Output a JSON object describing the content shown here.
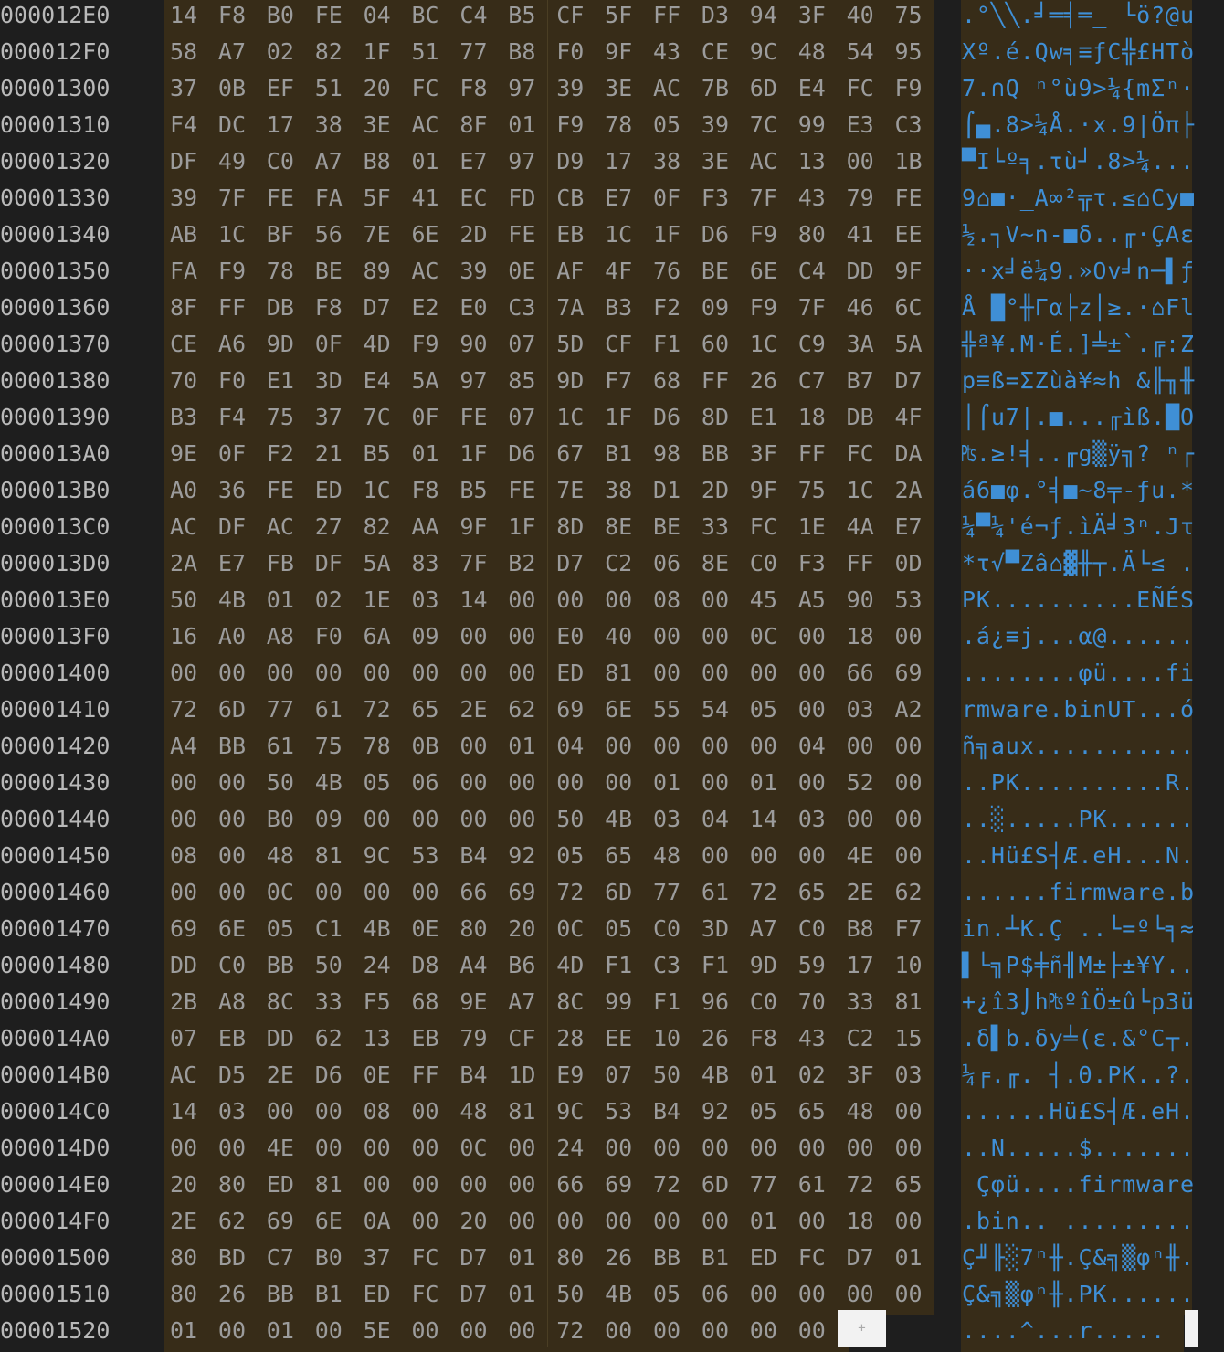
{
  "rows": [
    {
      "addr": "000012E0",
      "bytes": [
        "14",
        "F8",
        "B0",
        "FE",
        "04",
        "BC",
        "C4",
        "B5",
        "CF",
        "5F",
        "FF",
        "D3",
        "94",
        "3F",
        "40",
        "75"
      ],
      "ascii": ".°╲╲.╛═╡═_ └ö?@u"
    },
    {
      "addr": "000012F0",
      "bytes": [
        "58",
        "A7",
        "02",
        "82",
        "1F",
        "51",
        "77",
        "B8",
        "F0",
        "9F",
        "43",
        "CE",
        "9C",
        "48",
        "54",
        "95"
      ],
      "ascii": "Xº.é.Qw╕≡ƒC╬£HTò"
    },
    {
      "addr": "00001300",
      "bytes": [
        "37",
        "0B",
        "EF",
        "51",
        "20",
        "FC",
        "F8",
        "97",
        "39",
        "3E",
        "AC",
        "7B",
        "6D",
        "E4",
        "FC",
        "F9"
      ],
      "ascii": "7.∩Q ⁿ°ù9>¼{mΣⁿ·"
    },
    {
      "addr": "00001310",
      "bytes": [
        "F4",
        "DC",
        "17",
        "38",
        "3E",
        "AC",
        "8F",
        "01",
        "F9",
        "78",
        "05",
        "39",
        "7C",
        "99",
        "E3",
        "C3"
      ],
      "ascii": "⌠▄.8>¼Å.·x.9|Öπ├"
    },
    {
      "addr": "00001320",
      "bytes": [
        "DF",
        "49",
        "C0",
        "A7",
        "B8",
        "01",
        "E7",
        "97",
        "D9",
        "17",
        "38",
        "3E",
        "AC",
        "13",
        "00",
        "1B"
      ],
      "ascii": "▀I└º╕.τù┘.8>¼..."
    },
    {
      "addr": "00001330",
      "bytes": [
        "39",
        "7F",
        "FE",
        "FA",
        "5F",
        "41",
        "EC",
        "FD",
        "CB",
        "E7",
        "0F",
        "F3",
        "7F",
        "43",
        "79",
        "FE"
      ],
      "ascii": "9⌂■·_A∞²╦τ.≤⌂Cy■"
    },
    {
      "addr": "00001340",
      "bytes": [
        "AB",
        "1C",
        "BF",
        "56",
        "7E",
        "6E",
        "2D",
        "FE",
        "EB",
        "1C",
        "1F",
        "D6",
        "F9",
        "80",
        "41",
        "EE"
      ],
      "ascii": "½.┐V~n-■δ..╓·ÇAε"
    },
    {
      "addr": "00001350",
      "bytes": [
        "FA",
        "F9",
        "78",
        "BE",
        "89",
        "AC",
        "39",
        "0E",
        "AF",
        "4F",
        "76",
        "BE",
        "6E",
        "C4",
        "DD",
        "9F"
      ],
      "ascii": "··x╛ë¼9.»Ov╛n─▌ƒ"
    },
    {
      "addr": "00001360",
      "bytes": [
        "8F",
        "FF",
        "DB",
        "F8",
        "D7",
        "E2",
        "E0",
        "C3",
        "7A",
        "B3",
        "F2",
        "09",
        "F9",
        "7F",
        "46",
        "6C"
      ],
      "ascii": "Å █°╫Γα├z│≥.·⌂Fl"
    },
    {
      "addr": "00001370",
      "bytes": [
        "CE",
        "A6",
        "9D",
        "0F",
        "4D",
        "F9",
        "90",
        "07",
        "5D",
        "CF",
        "F1",
        "60",
        "1C",
        "C9",
        "3A",
        "5A"
      ],
      "ascii": "╬ª¥.M·É.]╧±`.╔:Z"
    },
    {
      "addr": "00001380",
      "bytes": [
        "70",
        "F0",
        "E1",
        "3D",
        "E4",
        "5A",
        "97",
        "85",
        "9D",
        "F7",
        "68",
        "FF",
        "26",
        "C7",
        "B7",
        "D7"
      ],
      "ascii": "p≡ß=ΣZùà¥≈h &╟╖╫"
    },
    {
      "addr": "00001390",
      "bytes": [
        "B3",
        "F4",
        "75",
        "37",
        "7C",
        "0F",
        "FE",
        "07",
        "1C",
        "1F",
        "D6",
        "8D",
        "E1",
        "18",
        "DB",
        "4F"
      ],
      "ascii": "│⌠u7|.■...╓ìß.█O"
    },
    {
      "addr": "000013A0",
      "bytes": [
        "9E",
        "0F",
        "F2",
        "21",
        "B5",
        "01",
        "1F",
        "D6",
        "67",
        "B1",
        "98",
        "BB",
        "3F",
        "FF",
        "FC",
        "DA"
      ],
      "ascii": "₧.≥!╡..╓g▒ÿ╗? ⁿ┌"
    },
    {
      "addr": "000013B0",
      "bytes": [
        "A0",
        "36",
        "FE",
        "ED",
        "1C",
        "F8",
        "B5",
        "FE",
        "7E",
        "38",
        "D1",
        "2D",
        "9F",
        "75",
        "1C",
        "2A"
      ],
      "ascii": "á6■φ.°╡■~8╤-ƒu.*"
    },
    {
      "addr": "000013C0",
      "bytes": [
        "AC",
        "DF",
        "AC",
        "27",
        "82",
        "AA",
        "9F",
        "1F",
        "8D",
        "8E",
        "BE",
        "33",
        "FC",
        "1E",
        "4A",
        "E7"
      ],
      "ascii": "¼▀¼'é¬ƒ.ìÄ╛3ⁿ.Jτ"
    },
    {
      "addr": "000013D0",
      "bytes": [
        "2A",
        "E7",
        "FB",
        "DF",
        "5A",
        "83",
        "7F",
        "B2",
        "D7",
        "C2",
        "06",
        "8E",
        "C0",
        "F3",
        "FF",
        "0D"
      ],
      "ascii": "*τ√▀Zâ⌂▓╫┬.Ä└≤ ."
    },
    {
      "addr": "000013E0",
      "bytes": [
        "50",
        "4B",
        "01",
        "02",
        "1E",
        "03",
        "14",
        "00",
        "00",
        "00",
        "08",
        "00",
        "45",
        "A5",
        "90",
        "53"
      ],
      "ascii": "PK..........EÑÉS"
    },
    {
      "addr": "000013F0",
      "bytes": [
        "16",
        "A0",
        "A8",
        "F0",
        "6A",
        "09",
        "00",
        "00",
        "E0",
        "40",
        "00",
        "00",
        "0C",
        "00",
        "18",
        "00"
      ],
      "ascii": ".á¿≡j...α@......"
    },
    {
      "addr": "00001400",
      "bytes": [
        "00",
        "00",
        "00",
        "00",
        "00",
        "00",
        "00",
        "00",
        "ED",
        "81",
        "00",
        "00",
        "00",
        "00",
        "66",
        "69"
      ],
      "ascii": "........φü....fi"
    },
    {
      "addr": "00001410",
      "bytes": [
        "72",
        "6D",
        "77",
        "61",
        "72",
        "65",
        "2E",
        "62",
        "69",
        "6E",
        "55",
        "54",
        "05",
        "00",
        "03",
        "A2"
      ],
      "ascii": "rmware.binUT...ó"
    },
    {
      "addr": "00001420",
      "bytes": [
        "A4",
        "BB",
        "61",
        "75",
        "78",
        "0B",
        "00",
        "01",
        "04",
        "00",
        "00",
        "00",
        "00",
        "04",
        "00",
        "00"
      ],
      "ascii": "ñ╗aux..........."
    },
    {
      "addr": "00001430",
      "bytes": [
        "00",
        "00",
        "50",
        "4B",
        "05",
        "06",
        "00",
        "00",
        "00",
        "00",
        "01",
        "00",
        "01",
        "00",
        "52",
        "00"
      ],
      "ascii": "..PK..........R."
    },
    {
      "addr": "00001440",
      "bytes": [
        "00",
        "00",
        "B0",
        "09",
        "00",
        "00",
        "00",
        "00",
        "50",
        "4B",
        "03",
        "04",
        "14",
        "03",
        "00",
        "00"
      ],
      "ascii": "..░.....PK......"
    },
    {
      "addr": "00001450",
      "bytes": [
        "08",
        "00",
        "48",
        "81",
        "9C",
        "53",
        "B4",
        "92",
        "05",
        "65",
        "48",
        "00",
        "00",
        "00",
        "4E",
        "00"
      ],
      "ascii": "..Hü£S┤Æ.eH...N."
    },
    {
      "addr": "00001460",
      "bytes": [
        "00",
        "00",
        "0C",
        "00",
        "00",
        "00",
        "66",
        "69",
        "72",
        "6D",
        "77",
        "61",
        "72",
        "65",
        "2E",
        "62"
      ],
      "ascii": "......firmware.b"
    },
    {
      "addr": "00001470",
      "bytes": [
        "69",
        "6E",
        "05",
        "C1",
        "4B",
        "0E",
        "80",
        "20",
        "0C",
        "05",
        "C0",
        "3D",
        "A7",
        "C0",
        "B8",
        "F7"
      ],
      "ascii": "in.┴K.Ç ..└=º└╕≈"
    },
    {
      "addr": "00001480",
      "bytes": [
        "DD",
        "C0",
        "BB",
        "50",
        "24",
        "D8",
        "A4",
        "B6",
        "4D",
        "F1",
        "C3",
        "F1",
        "9D",
        "59",
        "17",
        "10"
      ],
      "ascii": "▌└╗P$╪ñ╢M±├±¥Y.."
    },
    {
      "addr": "00001490",
      "bytes": [
        "2B",
        "A8",
        "8C",
        "33",
        "F5",
        "68",
        "9E",
        "A7",
        "8C",
        "99",
        "F1",
        "96",
        "C0",
        "70",
        "33",
        "81"
      ],
      "ascii": "+¿î3⌡h₧ºîÖ±û└p3ü"
    },
    {
      "addr": "000014A0",
      "bytes": [
        "07",
        "EB",
        "DD",
        "62",
        "13",
        "EB",
        "79",
        "CF",
        "28",
        "EE",
        "10",
        "26",
        "F8",
        "43",
        "C2",
        "15"
      ],
      "ascii": ".δ▌b.δy╧(ε.&°C┬."
    },
    {
      "addr": "000014B0",
      "bytes": [
        "AC",
        "D5",
        "2E",
        "D6",
        "0E",
        "FF",
        "B4",
        "1D",
        "E9",
        "07",
        "50",
        "4B",
        "01",
        "02",
        "3F",
        "03"
      ],
      "ascii": "¼╒.╓. ┤.Θ.PK..?."
    },
    {
      "addr": "000014C0",
      "bytes": [
        "14",
        "03",
        "00",
        "00",
        "08",
        "00",
        "48",
        "81",
        "9C",
        "53",
        "B4",
        "92",
        "05",
        "65",
        "48",
        "00"
      ],
      "ascii": "......Hü£S┤Æ.eH."
    },
    {
      "addr": "000014D0",
      "bytes": [
        "00",
        "00",
        "4E",
        "00",
        "00",
        "00",
        "0C",
        "00",
        "24",
        "00",
        "00",
        "00",
        "00",
        "00",
        "00",
        "00"
      ],
      "ascii": "..N.....$......."
    },
    {
      "addr": "000014E0",
      "bytes": [
        "20",
        "80",
        "ED",
        "81",
        "00",
        "00",
        "00",
        "00",
        "66",
        "69",
        "72",
        "6D",
        "77",
        "61",
        "72",
        "65"
      ],
      "ascii": " Çφü....firmware"
    },
    {
      "addr": "000014F0",
      "bytes": [
        "2E",
        "62",
        "69",
        "6E",
        "0A",
        "00",
        "20",
        "00",
        "00",
        "00",
        "00",
        "00",
        "01",
        "00",
        "18",
        "00"
      ],
      "ascii": ".bin.. ........."
    },
    {
      "addr": "00001500",
      "bytes": [
        "80",
        "BD",
        "C7",
        "B0",
        "37",
        "FC",
        "D7",
        "01",
        "80",
        "26",
        "BB",
        "B1",
        "ED",
        "FC",
        "D7",
        "01"
      ],
      "ascii": "Ç╜╟░7ⁿ╫.Ç&╗▒φⁿ╫."
    },
    {
      "addr": "00001510",
      "bytes": [
        "80",
        "26",
        "BB",
        "B1",
        "ED",
        "FC",
        "D7",
        "01",
        "50",
        "4B",
        "05",
        "06",
        "00",
        "00",
        "00",
        "00"
      ],
      "ascii": "Ç&╗▒φⁿ╫.PK......"
    },
    {
      "addr": "00001520",
      "bytes": [
        "01",
        "00",
        "01",
        "00",
        "5E",
        "00",
        "00",
        "00",
        "72",
        "00",
        "00",
        "00",
        "00",
        "00"
      ],
      "ascii": "....^...r....."
    }
  ],
  "cursor": {
    "symbol": "+"
  }
}
